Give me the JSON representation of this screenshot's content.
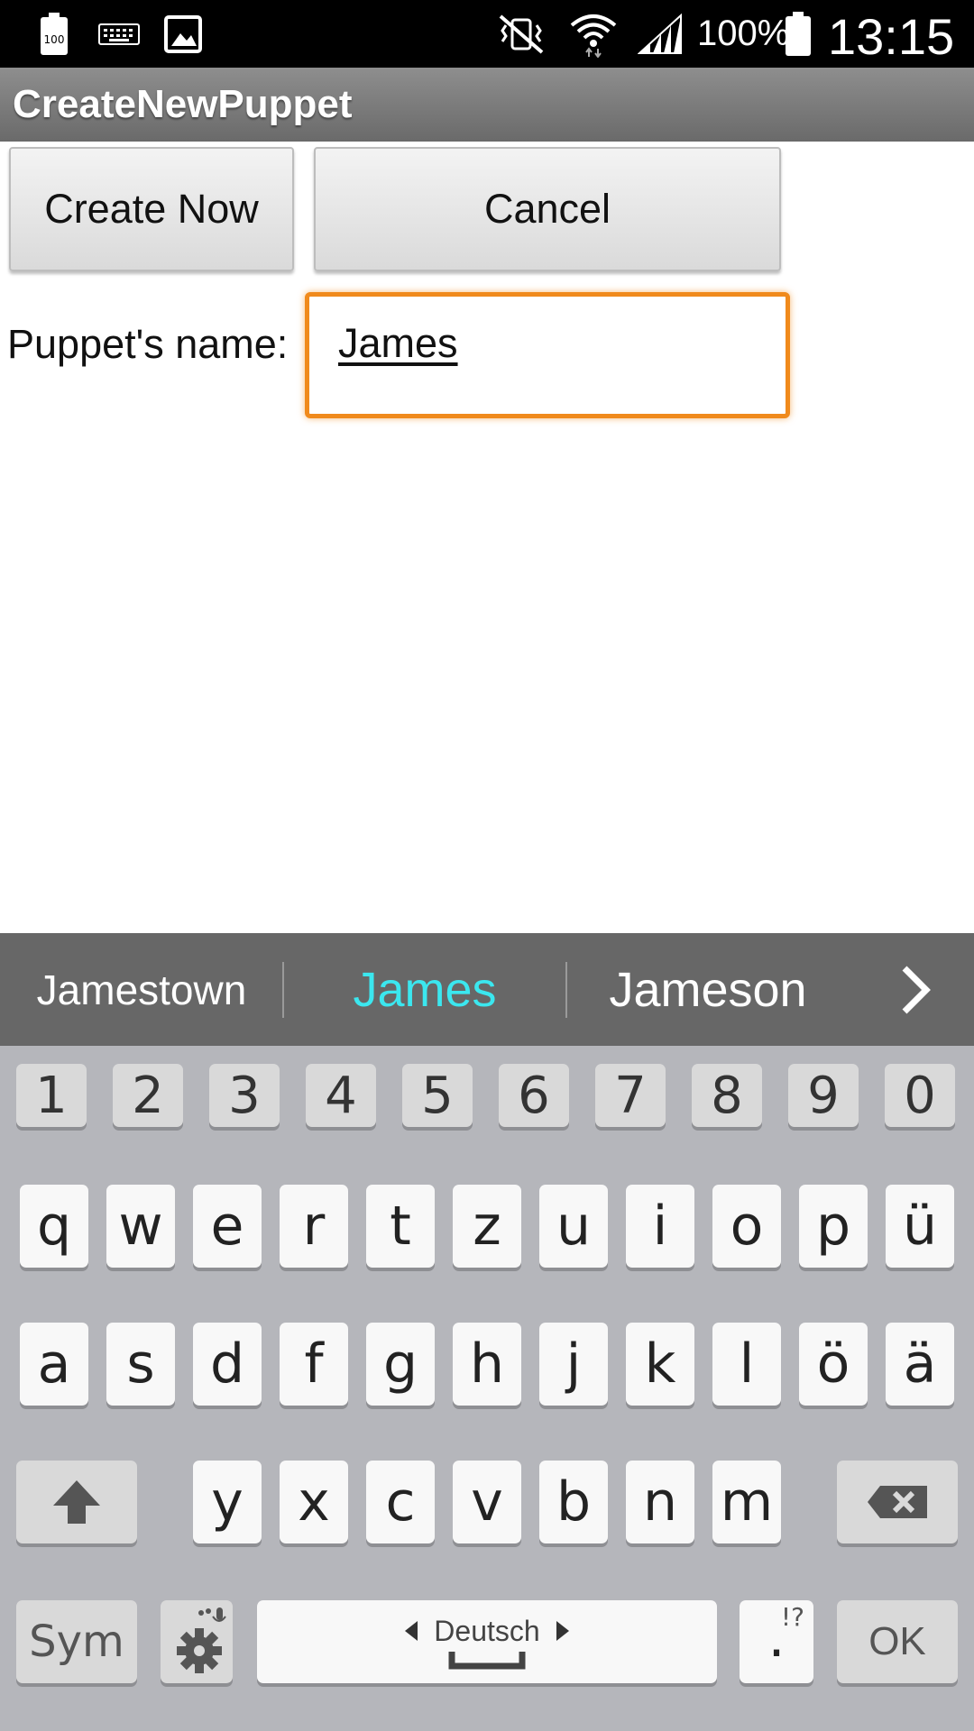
{
  "status_bar": {
    "left_icons": [
      "battery-100-icon",
      "keyboard-icon",
      "image-icon"
    ],
    "right_icons": [
      "vibrate-mute-icon",
      "wifi-icon",
      "signal-icon",
      "battery-icon"
    ],
    "battery_text": "100%",
    "battery_small": "100",
    "time": "13:15"
  },
  "app": {
    "title": "CreateNewPuppet",
    "create_button": "Create Now",
    "cancel_button": "Cancel",
    "name_label": "Puppet's name:",
    "name_value": "James",
    "accent_color": "#f08a1c"
  },
  "keyboard": {
    "suggestions": [
      "Jamestown",
      "James",
      "Jameson"
    ],
    "selected_suggestion": "James",
    "selected_color": "#3be7ef",
    "number_row": [
      "1",
      "2",
      "3",
      "4",
      "5",
      "6",
      "7",
      "8",
      "9",
      "0"
    ],
    "row1": [
      "q",
      "w",
      "e",
      "r",
      "t",
      "z",
      "u",
      "i",
      "o",
      "p",
      "ü"
    ],
    "row2": [
      "a",
      "s",
      "d",
      "f",
      "g",
      "h",
      "j",
      "k",
      "l",
      "ö",
      "ä"
    ],
    "row3": [
      "y",
      "x",
      "c",
      "v",
      "b",
      "n",
      "m"
    ],
    "sym_label": "Sym",
    "language_label": "Deutsch",
    "period_label": ".",
    "punct_hint": "!?",
    "ok_label": "OK"
  }
}
